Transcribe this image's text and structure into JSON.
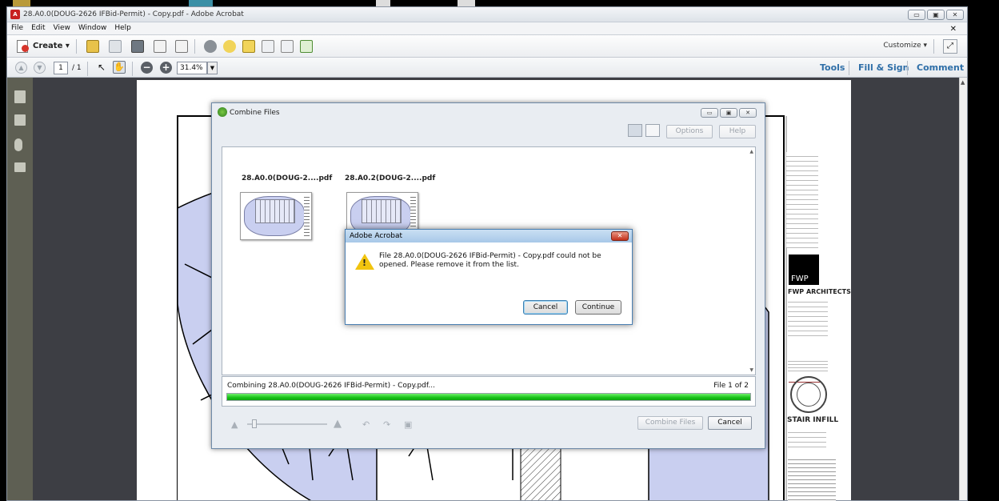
{
  "window": {
    "title": "28.A0.0(DOUG-2626 IFBid-Permit) - Copy.pdf - Adobe Acrobat",
    "controls": [
      "▭",
      "▣",
      "✕"
    ]
  },
  "menu": [
    "File",
    "Edit",
    "View",
    "Window",
    "Help"
  ],
  "toolbar": {
    "create_label": "Create",
    "customize_label": "Customize"
  },
  "nav": {
    "page_current": "1",
    "page_total": "/ 1",
    "zoom": "31.4%"
  },
  "right_links": [
    "Tools",
    "Fill & Sign",
    "Comment"
  ],
  "combine": {
    "title": "Combine Files",
    "options_label": "Options",
    "help_label": "Help",
    "files": [
      {
        "name": "28.A0.0(DOUG-2....pdf"
      },
      {
        "name": "28.A0.2(DOUG-2....pdf"
      }
    ],
    "progress_text": "Combining 28.A0.0(DOUG-2626 IFBid-Permit) - Copy.pdf...",
    "progress_count": "File 1 of 2",
    "progress_fraction": 1.0,
    "combine_label": "Combine Files",
    "cancel_label": "Cancel"
  },
  "alert": {
    "title": "Adobe Acrobat",
    "message": "File 28.A0.0(DOUG-2626 IFBid-Permit) - Copy.pdf could not be opened. Please remove it from the list.",
    "cancel_label": "Cancel",
    "continue_label": "Continue"
  },
  "titleblock": {
    "logo": "FWP",
    "firm": "FWP ARCHITECTS",
    "project": "STAIR INFILL"
  },
  "colors": {
    "accent_link": "#2f6fa8",
    "progress": "#17c217",
    "plan_fill": "#c9cff0"
  }
}
